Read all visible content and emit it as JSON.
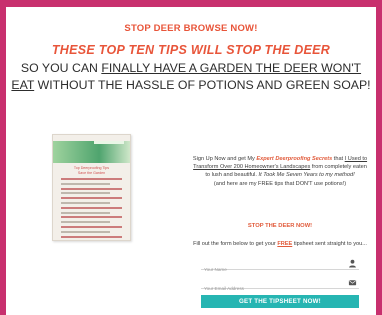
{
  "colors": {
    "border": "#c8306e",
    "accent": "#e8553a",
    "button": "#26b5b2",
    "text": "#2d2d2d"
  },
  "headline": "STOP DEER BROWSE NOW!",
  "subheadline": "THESE TOP TEN TIPS WILL STOP THE DEER",
  "body": {
    "part1": "SO YOU CAN ",
    "underline1": "FINALLY HAVE A GARDEN THE DEER WON'T EAT",
    "part2": " WITHOUT THE HASSLE OF POTIONS AND GREEN SOAP!"
  },
  "tipsheet_image": {
    "title_line1": "Top Deerproofing Tips",
    "title_line2": "Save the Garden"
  },
  "description": {
    "p1": "Sign Up Now and get My ",
    "emph": "Expert Deerproofing Secrets",
    "p2": " that ",
    "underline": "I Used to Transform Over 200 Homeowner's Landscapes",
    "p3": " from completely eaten to lush and beautiful. ",
    "italic": "It Took Me Seven Years to my method!",
    "p4": "(and here are my FREE tips that DON'T use potions!)"
  },
  "stop_callout": "STOP THE DEER NOW!",
  "form_intro": {
    "p1": "Fill out the form below to get your ",
    "free": "FREE",
    "p2": " tipsheet sent straight to you..."
  },
  "form": {
    "name_placeholder": "Your Name",
    "email_placeholder": "Your Email Address",
    "name_icon": "user-icon",
    "email_icon": "envelope-icon",
    "submit_label": "GET THE TIPSHEET NOW!"
  }
}
